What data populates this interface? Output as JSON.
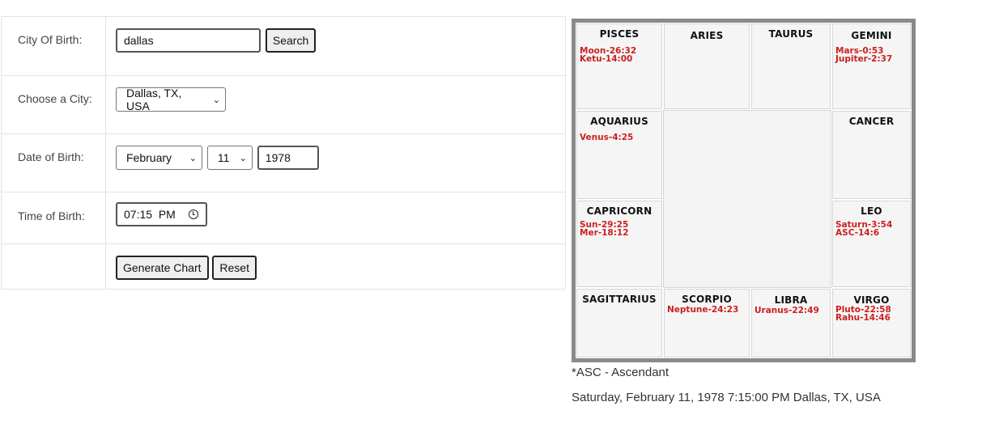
{
  "form": {
    "city_label": "City Of Birth:",
    "city_value": "dallas",
    "search_label": "Search",
    "choose_city_label": "Choose a City:",
    "choose_city_value": "Dallas, TX, USA",
    "dob_label": "Date of Birth:",
    "month_value": "February",
    "day_value": "11",
    "year_value": "1978",
    "tob_label": "Time of Birth:",
    "time_value": "07:15  PM",
    "generate_label": "Generate Chart",
    "reset_label": "Reset"
  },
  "chart": {
    "houses": [
      {
        "sign": "PISCES",
        "planets": [
          "Moon-26:32",
          "Ketu-14:00"
        ]
      },
      {
        "sign": "ARIES",
        "planets": []
      },
      {
        "sign": "TAURUS",
        "planets": []
      },
      {
        "sign": "GEMINI",
        "planets": [
          "Mars-0:53",
          "Jupiter-2:37"
        ]
      },
      {
        "sign": "AQUARIUS",
        "planets": [
          "Venus-4:25"
        ]
      },
      {
        "sign": "CANCER",
        "planets": []
      },
      {
        "sign": "CAPRICORN",
        "planets": [
          "Sun-29:25",
          "Mer-18:12"
        ]
      },
      {
        "sign": "LEO",
        "planets": [
          "Saturn-3:54",
          "ASC-14:6"
        ]
      },
      {
        "sign": "SAGITTARIUS",
        "planets": []
      },
      {
        "sign": "SCORPIO",
        "planets": [
          "Neptune-24:23"
        ]
      },
      {
        "sign": "LIBRA",
        "planets": [
          "Uranus-22:49"
        ]
      },
      {
        "sign": "VIRGO",
        "planets": [
          "Pluto-22:58",
          "Rahu-14:46"
        ]
      }
    ]
  },
  "notes": {
    "legend": "*ASC - Ascendant",
    "summary": "Saturday, February 11, 1978 7:15:00 PM Dallas, TX, USA"
  }
}
